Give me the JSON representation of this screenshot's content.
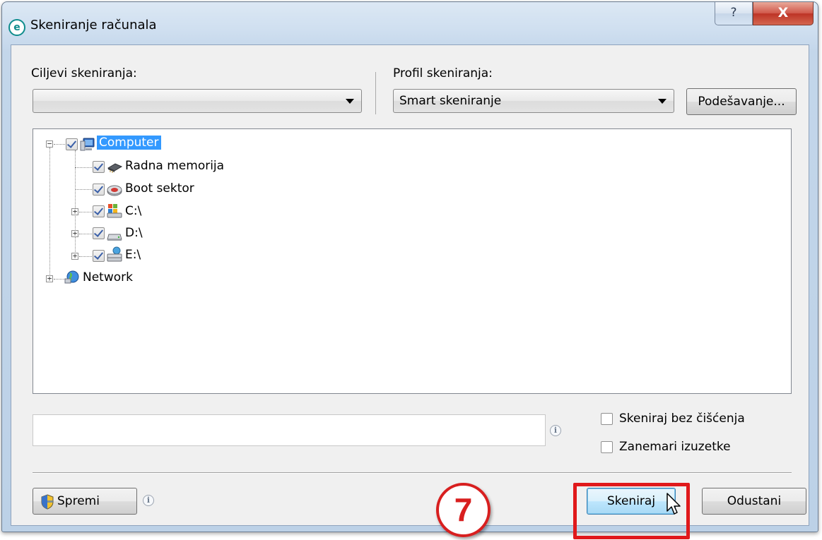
{
  "window": {
    "title": "Skeniranje računala",
    "app_icon_letter": "e",
    "help_glyph": "?",
    "close_glyph": "X"
  },
  "targets": {
    "label": "Ciljevi skeniranja:",
    "selected": ""
  },
  "profile": {
    "label": "Profil skeniranja:",
    "selected": "Smart skeniranje",
    "settings_button": "Podešavanje..."
  },
  "tree": {
    "items": [
      {
        "label": "Computer",
        "checked": true,
        "icon": "computer-icon",
        "selected": true
      },
      {
        "label": "Radna memorija",
        "checked": true,
        "icon": "memory-chip-icon"
      },
      {
        "label": "Boot sektor",
        "checked": true,
        "icon": "boot-disk-icon"
      },
      {
        "label": "C:\\",
        "checked": true,
        "icon": "system-drive-icon"
      },
      {
        "label": "D:\\",
        "checked": true,
        "icon": "hard-drive-icon"
      },
      {
        "label": "E:\\",
        "checked": true,
        "icon": "network-drive-icon"
      },
      {
        "label": "Network",
        "icon": "network-globe-icon"
      }
    ]
  },
  "path_input": {
    "value": ""
  },
  "options": {
    "scan_without_cleaning": {
      "label": "Skeniraj bez čišćenja",
      "checked": false
    },
    "ignore_exclusions": {
      "label": "Zanemari izuzetke",
      "checked": false
    }
  },
  "footer": {
    "save_button": "Spremi",
    "step_number": "7",
    "scan_button": "Skeniraj",
    "cancel_button": "Odustani"
  },
  "colors": {
    "selection": "#3399ff",
    "highlight_red": "#e0191b",
    "checkmark": "#3a5fa8"
  }
}
